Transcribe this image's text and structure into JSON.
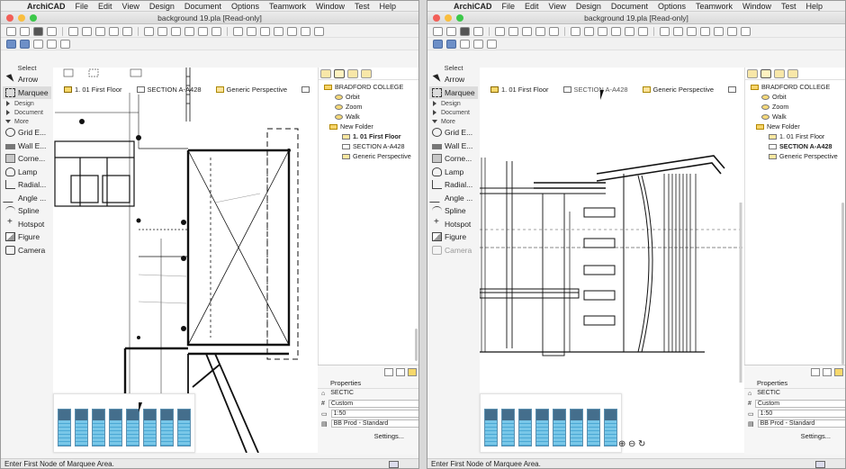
{
  "menubar": {
    "app_name": "ArchiCAD",
    "items": [
      "File",
      "Edit",
      "View",
      "Design",
      "Document",
      "Options",
      "Teamwork",
      "Window",
      "Test",
      "Help"
    ]
  },
  "window": {
    "title": "background 19.pla [Read-only]"
  },
  "toolbox": {
    "header": "Select",
    "items": [
      {
        "label": "Arrow",
        "icon": "arrow-icon"
      },
      {
        "label": "Marquee",
        "icon": "marquee-icon",
        "selected": true
      },
      {
        "label": "Design",
        "group": true
      },
      {
        "label": "Document",
        "group": true
      },
      {
        "label": "More",
        "group": true
      },
      {
        "label": "Grid E...",
        "icon": "grid-icon"
      },
      {
        "label": "Wall E...",
        "icon": "wall-icon"
      },
      {
        "label": "Corne...",
        "icon": "corner-icon"
      },
      {
        "label": "Lamp",
        "icon": "lamp-icon"
      },
      {
        "label": "Radial...",
        "icon": "radial-icon"
      },
      {
        "label": "Angle ...",
        "icon": "angle-icon"
      },
      {
        "label": "Spline",
        "icon": "spline-icon"
      },
      {
        "label": "Hotspot",
        "icon": "hotspot-icon"
      },
      {
        "label": "Figure",
        "icon": "figure-icon"
      },
      {
        "label": "Camera",
        "icon": "camera-icon"
      }
    ]
  },
  "tabs": [
    {
      "label": "1. 01 First Floor",
      "icon": "floor-plan-icon"
    },
    {
      "label": "SECTION A-A428",
      "icon": "section-icon"
    },
    {
      "label": "Generic Perspective",
      "icon": "perspective-icon"
    }
  ],
  "navigator": {
    "project": "BRADFORD COLLEGE",
    "items": [
      {
        "label": "Orbit",
        "level": 1,
        "icon": "eye-icon"
      },
      {
        "label": "Zoom",
        "level": 1,
        "icon": "eye-icon"
      },
      {
        "label": "Walk",
        "level": 1,
        "icon": "eye-icon"
      },
      {
        "label": "New Folder",
        "level": 1,
        "icon": "folder-icon"
      },
      {
        "label": "1. 01 First Floor",
        "level": 2,
        "icon": "floor-plan-icon"
      },
      {
        "label": "SECTION A-A428",
        "level": 2,
        "icon": "section-icon"
      },
      {
        "label": "Generic Perspective",
        "level": 2,
        "icon": "perspective-icon"
      }
    ]
  },
  "properties": {
    "title": "Properties",
    "rows": [
      {
        "key": "",
        "value": "SECTIC"
      },
      {
        "key": "#",
        "value": "Custom"
      },
      {
        "key": "",
        "value": "1:50"
      },
      {
        "key": "",
        "value": "BB Prod - Standard"
      }
    ],
    "settings_label": "Settings..."
  },
  "status": {
    "text": "Enter First Node of Marquee Area."
  },
  "panes": {
    "left": {
      "bold_nav_index": 4
    },
    "right": {
      "bold_nav_index": 5
    }
  }
}
